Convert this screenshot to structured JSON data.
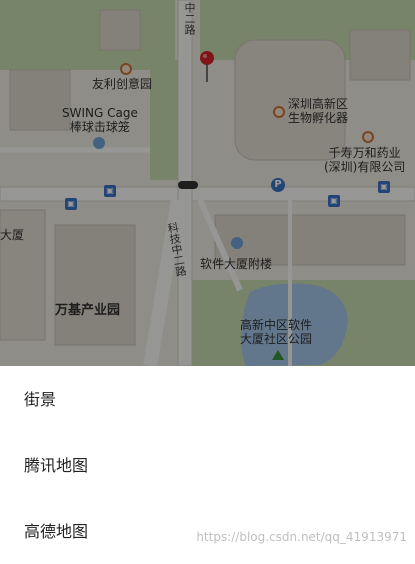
{
  "map": {
    "labels": {
      "road_top": "中二路",
      "poi_youli": "友利创意园",
      "poi_swing": "SWING Cage\n棒球击球笼",
      "poi_incubator": "深圳高新区\n生物孵化器",
      "poi_qianshou": "千寿万和药业\n(深圳)有限公司",
      "poi_dasha": "大厦",
      "road_keji": "科技中二路",
      "poi_ruanjian": "软件大厦附楼",
      "poi_wanji": "万基产业园",
      "poi_park": "高新中区软件\n大厦社区公园"
    },
    "parking_label": "P"
  },
  "sheet": {
    "items": [
      "街景",
      "腾讯地图",
      "高德地图"
    ]
  },
  "watermark": "https://blog.csdn.net/qq_41913971"
}
